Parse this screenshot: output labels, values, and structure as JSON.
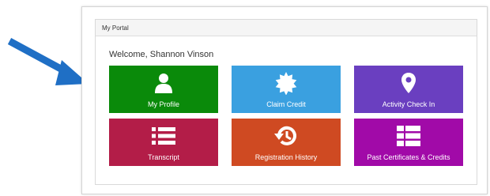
{
  "panel": {
    "title": "My Portal",
    "welcome": "Welcome, Shannon Vinson"
  },
  "tiles": [
    {
      "label": "My Profile",
      "icon": "user-icon",
      "color": "#0a8a0a"
    },
    {
      "label": "Claim Credit",
      "icon": "badge-icon",
      "color": "#3aa0e0"
    },
    {
      "label": "Activity Check In",
      "icon": "map-pin-icon",
      "color": "#6a3fc0"
    },
    {
      "label": "Transcript",
      "icon": "list-icon",
      "color": "#b31d48"
    },
    {
      "label": "Registration History",
      "icon": "history-icon",
      "color": "#cf4a22"
    },
    {
      "label": "Past Certificates & Credits",
      "icon": "grid-list-icon",
      "color": "#a10aa8"
    }
  ],
  "annotation": {
    "arrow_color": "#1f6fc5",
    "arrow_icon": "arrow-pointer-icon"
  }
}
